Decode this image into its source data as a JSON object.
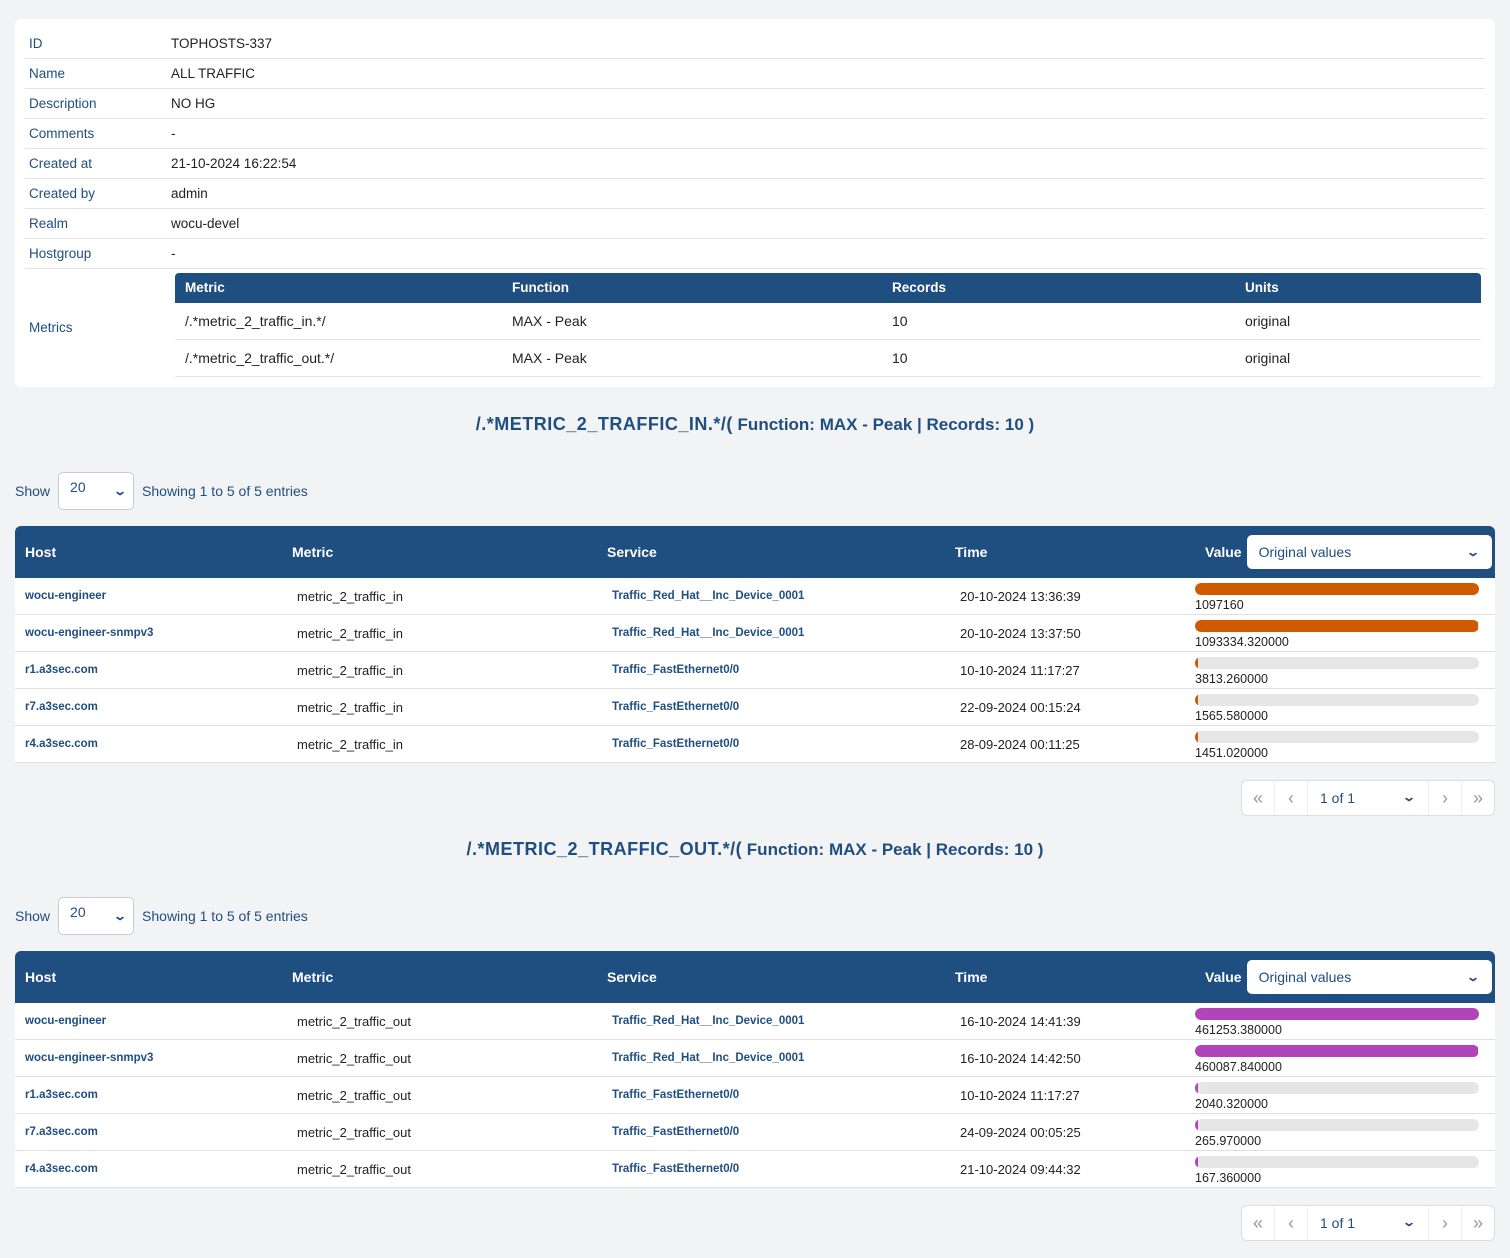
{
  "details": [
    {
      "label": "ID",
      "value": "TOPHOSTS-337"
    },
    {
      "label": "Name",
      "value": "ALL TRAFFIC"
    },
    {
      "label": "Description",
      "value": "NO HG"
    },
    {
      "label": "Comments",
      "value": "-"
    },
    {
      "label": "Created at",
      "value": "21-10-2024 16:22:54"
    },
    {
      "label": "Created by",
      "value": "admin"
    },
    {
      "label": "Realm",
      "value": "wocu-devel"
    },
    {
      "label": "Hostgroup",
      "value": "-"
    }
  ],
  "metrics": {
    "label": "Metrics",
    "headers": [
      "Metric",
      "Function",
      "Records",
      "Units"
    ],
    "rows": [
      [
        "/.*metric_2_traffic_in.*/",
        "MAX - Peak",
        "10",
        "original"
      ],
      [
        "/.*metric_2_traffic_out.*/",
        "MAX - Peak",
        "10",
        "original"
      ]
    ]
  },
  "sections": [
    {
      "title_main": "/.*METRIC_2_TRAFFIC_IN.*/(",
      "title_rest": " Function: MAX - Peak | Records: 10 )",
      "show_label": "Show",
      "page_size": "20",
      "showing": "Showing 1 to 5 of 5 entries",
      "headers": [
        "Host",
        "Metric",
        "Service",
        "Time",
        "Value"
      ],
      "value_select": "Original values",
      "bar_color": "#d05a00",
      "rows": [
        {
          "host": "wocu-engineer",
          "metric": "metric_2_traffic_in",
          "service": "Traffic_Red_Hat__Inc_Device_0001",
          "time": "20-10-2024 13:36:39",
          "value": "1097160",
          "fraction": 1.0
        },
        {
          "host": "wocu-engineer-snmpv3",
          "metric": "metric_2_traffic_in",
          "service": "Traffic_Red_Hat__Inc_Device_0001",
          "time": "20-10-2024 13:37:50",
          "value": "1093334.320000",
          "fraction": 0.9965
        },
        {
          "host": "r1.a3sec.com",
          "metric": "metric_2_traffic_in",
          "service": "Traffic_FastEthernet0/0",
          "time": "10-10-2024 11:17:27",
          "value": "3813.260000",
          "fraction": 0.0035
        },
        {
          "host": "r7.a3sec.com",
          "metric": "metric_2_traffic_in",
          "service": "Traffic_FastEthernet0/0",
          "time": "22-09-2024 00:15:24",
          "value": "1565.580000",
          "fraction": 0.0014
        },
        {
          "host": "r4.a3sec.com",
          "metric": "metric_2_traffic_in",
          "service": "Traffic_FastEthernet0/0",
          "time": "28-09-2024 00:11:25",
          "value": "1451.020000",
          "fraction": 0.0013
        }
      ],
      "pagination": "1 of 1"
    },
    {
      "title_main": "/.*METRIC_2_TRAFFIC_OUT.*/(",
      "title_rest": " Function: MAX - Peak | Records: 10 )",
      "show_label": "Show",
      "page_size": "20",
      "showing": "Showing 1 to 5 of 5 entries",
      "headers": [
        "Host",
        "Metric",
        "Service",
        "Time",
        "Value"
      ],
      "value_select": "Original values",
      "bar_color": "#b044b8",
      "rows": [
        {
          "host": "wocu-engineer",
          "metric": "metric_2_traffic_out",
          "service": "Traffic_Red_Hat__Inc_Device_0001",
          "time": "16-10-2024 14:41:39",
          "value": "461253.380000",
          "fraction": 1.0
        },
        {
          "host": "wocu-engineer-snmpv3",
          "metric": "metric_2_traffic_out",
          "service": "Traffic_Red_Hat__Inc_Device_0001",
          "time": "16-10-2024 14:42:50",
          "value": "460087.840000",
          "fraction": 0.9975
        },
        {
          "host": "r1.a3sec.com",
          "metric": "metric_2_traffic_out",
          "service": "Traffic_FastEthernet0/0",
          "time": "10-10-2024 11:17:27",
          "value": "2040.320000",
          "fraction": 0.0044
        },
        {
          "host": "r7.a3sec.com",
          "metric": "metric_2_traffic_out",
          "service": "Traffic_FastEthernet0/0",
          "time": "24-09-2024 00:05:25",
          "value": "265.970000",
          "fraction": 0.0006
        },
        {
          "host": "r4.a3sec.com",
          "metric": "metric_2_traffic_out",
          "service": "Traffic_FastEthernet0/0",
          "time": "21-10-2024 09:44:32",
          "value": "167.360000",
          "fraction": 0.0004
        }
      ],
      "pagination": "1 of 1"
    }
  ]
}
